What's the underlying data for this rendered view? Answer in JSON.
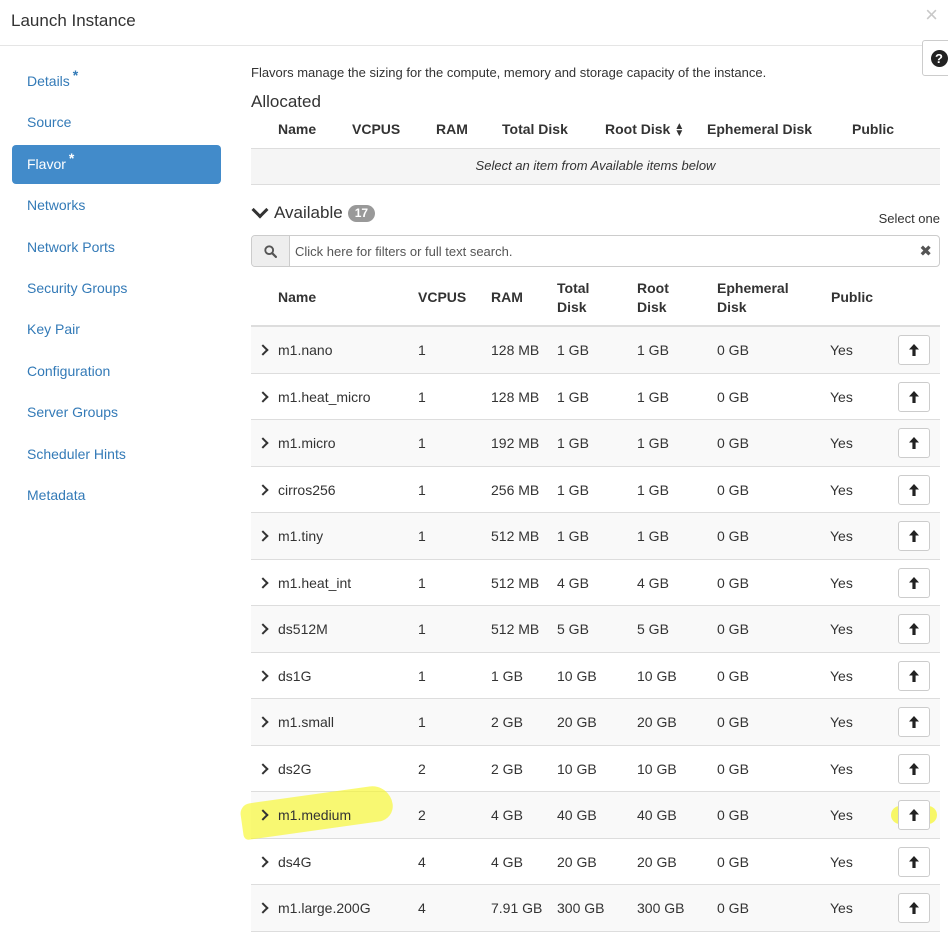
{
  "dialog": {
    "title": "Launch Instance",
    "close_symbol": "×",
    "help_symbol": "?"
  },
  "nav": {
    "items": [
      {
        "label": "Details",
        "required": "*"
      },
      {
        "label": "Source",
        "required": ""
      },
      {
        "label": "Flavor",
        "required": "*",
        "active": true
      },
      {
        "label": "Networks",
        "required": ""
      },
      {
        "label": "Network Ports",
        "required": ""
      },
      {
        "label": "Security Groups",
        "required": ""
      },
      {
        "label": "Key Pair",
        "required": ""
      },
      {
        "label": "Configuration",
        "required": ""
      },
      {
        "label": "Server Groups",
        "required": ""
      },
      {
        "label": "Scheduler Hints",
        "required": ""
      },
      {
        "label": "Metadata",
        "required": ""
      }
    ]
  },
  "flavor": {
    "description": "Flavors manage the sizing for the compute, memory and storage capacity of the instance.",
    "allocated": {
      "title": "Allocated",
      "columns": {
        "name": "Name",
        "vcpus": "VCPUS",
        "ram": "RAM",
        "total_disk": "Total Disk",
        "root_disk": "Root Disk",
        "ephemeral_disk": "Ephemeral Disk",
        "public": "Public"
      },
      "empty_text": "Select an item from Available items below"
    },
    "available": {
      "title": "Available",
      "count": "17",
      "select_one": "Select one",
      "search": {
        "placeholder": "Click here for filters or full text search.",
        "value": ""
      },
      "columns": {
        "name": "Name",
        "vcpus": "VCPUS",
        "ram": "RAM",
        "total_disk_1": "Total",
        "total_disk_2": "Disk",
        "root_disk_1": "Root",
        "root_disk_2": "Disk",
        "ephemeral_disk_1": "Ephemeral",
        "ephemeral_disk_2": "Disk",
        "public": "Public"
      },
      "rows": [
        {
          "name": "m1.nano",
          "vcpus": "1",
          "ram": "128 MB",
          "total_disk": "1 GB",
          "root_disk": "1 GB",
          "ephemeral_disk": "0 GB",
          "public": "Yes"
        },
        {
          "name": "m1.heat_micro",
          "vcpus": "1",
          "ram": "128 MB",
          "total_disk": "1 GB",
          "root_disk": "1 GB",
          "ephemeral_disk": "0 GB",
          "public": "Yes"
        },
        {
          "name": "m1.micro",
          "vcpus": "1",
          "ram": "192 MB",
          "total_disk": "1 GB",
          "root_disk": "1 GB",
          "ephemeral_disk": "0 GB",
          "public": "Yes"
        },
        {
          "name": "cirros256",
          "vcpus": "1",
          "ram": "256 MB",
          "total_disk": "1 GB",
          "root_disk": "1 GB",
          "ephemeral_disk": "0 GB",
          "public": "Yes"
        },
        {
          "name": "m1.tiny",
          "vcpus": "1",
          "ram": "512 MB",
          "total_disk": "1 GB",
          "root_disk": "1 GB",
          "ephemeral_disk": "0 GB",
          "public": "Yes"
        },
        {
          "name": "m1.heat_int",
          "vcpus": "1",
          "ram": "512 MB",
          "total_disk": "4 GB",
          "root_disk": "4 GB",
          "ephemeral_disk": "0 GB",
          "public": "Yes"
        },
        {
          "name": "ds512M",
          "vcpus": "1",
          "ram": "512 MB",
          "total_disk": "5 GB",
          "root_disk": "5 GB",
          "ephemeral_disk": "0 GB",
          "public": "Yes"
        },
        {
          "name": "ds1G",
          "vcpus": "1",
          "ram": "1 GB",
          "total_disk": "10 GB",
          "root_disk": "10 GB",
          "ephemeral_disk": "0 GB",
          "public": "Yes"
        },
        {
          "name": "m1.small",
          "vcpus": "1",
          "ram": "2 GB",
          "total_disk": "20 GB",
          "root_disk": "20 GB",
          "ephemeral_disk": "0 GB",
          "public": "Yes"
        },
        {
          "name": "ds2G",
          "vcpus": "2",
          "ram": "2 GB",
          "total_disk": "10 GB",
          "root_disk": "10 GB",
          "ephemeral_disk": "0 GB",
          "public": "Yes"
        },
        {
          "name": "m1.medium",
          "vcpus": "2",
          "ram": "4 GB",
          "total_disk": "40 GB",
          "root_disk": "40 GB",
          "ephemeral_disk": "0 GB",
          "public": "Yes",
          "highlighted": true
        },
        {
          "name": "ds4G",
          "vcpus": "4",
          "ram": "4 GB",
          "total_disk": "20 GB",
          "root_disk": "20 GB",
          "ephemeral_disk": "0 GB",
          "public": "Yes"
        },
        {
          "name": "m1.large.200G",
          "vcpus": "4",
          "ram": "7.91 GB",
          "total_disk": "300 GB",
          "root_disk": "300 GB",
          "ephemeral_disk": "0 GB",
          "public": "Yes"
        }
      ]
    }
  },
  "colors": {
    "link": "#337ab7",
    "active_nav": "#428bca",
    "highlight": "#f7f72a",
    "badge": "#999999"
  }
}
